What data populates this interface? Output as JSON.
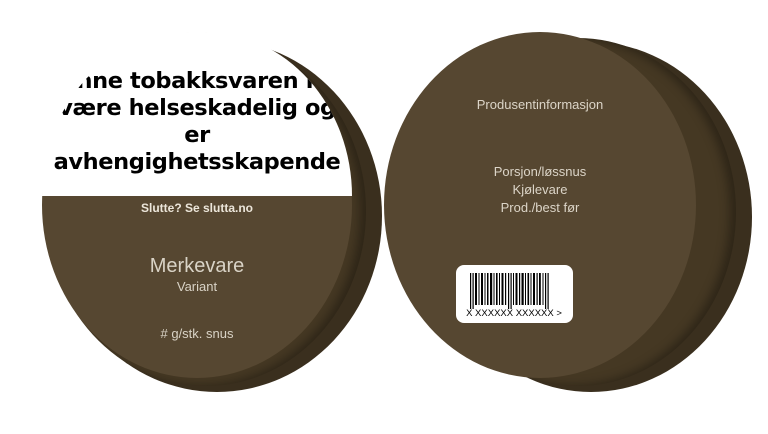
{
  "front_lid": {
    "warning": "Denne tobakksvaren kan være helseskadelig og er avhengighetsskapende",
    "quit_line": "Slutte? Se slutta.no",
    "brand": "Merkevare",
    "variant": "Variant",
    "amount": "# g/stk. snus"
  },
  "back_lid": {
    "producer": "Produsentinformasjon",
    "portion": "Porsjon/løssnus",
    "storage": "Kjølevare",
    "date": "Prod./best før",
    "barcode_text": "X XXXXXX XXXXXX >"
  },
  "colors": {
    "can_dark": "#3e3220",
    "can_mid": "#4a3d28",
    "lid": "#564731"
  }
}
